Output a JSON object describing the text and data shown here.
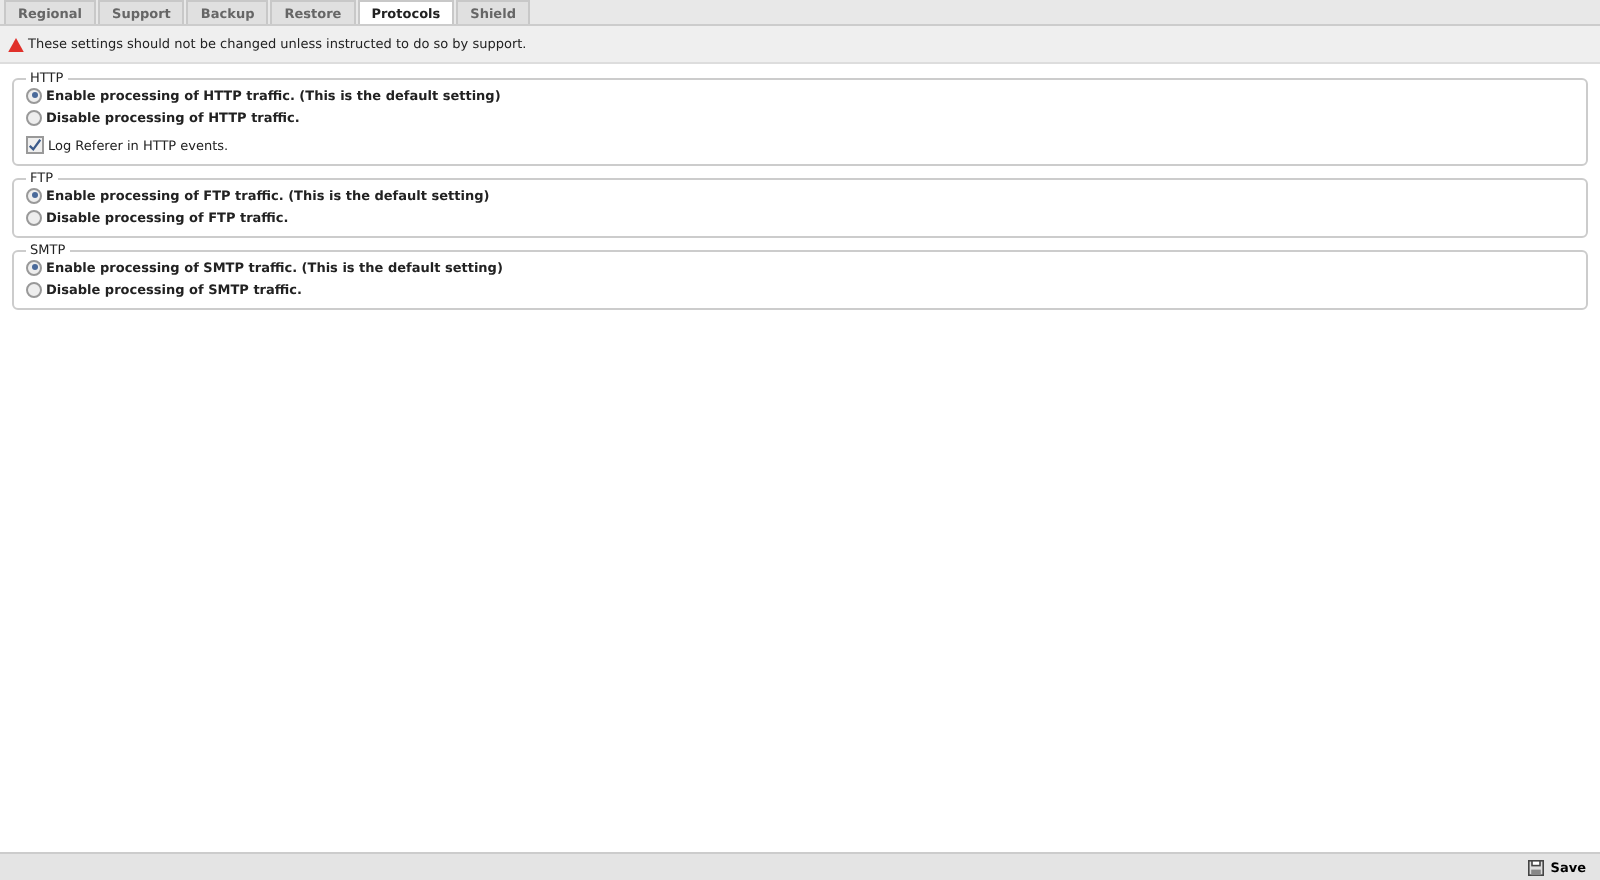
{
  "tabs": [
    {
      "label": "Regional",
      "selected": false
    },
    {
      "label": "Support",
      "selected": false
    },
    {
      "label": "Backup",
      "selected": false
    },
    {
      "label": "Restore",
      "selected": false
    },
    {
      "label": "Protocols",
      "selected": true
    },
    {
      "label": "Shield",
      "selected": false
    }
  ],
  "warning": "These settings should not be changed unless instructed to do so by support.",
  "groups": [
    {
      "legend": "HTTP",
      "items": [
        {
          "kind": "radio",
          "label": "Enable processing of HTTP traffic. (This is the default setting)",
          "selected": true
        },
        {
          "kind": "radio",
          "label": "Disable processing of HTTP traffic.",
          "selected": false
        },
        {
          "kind": "checkbox",
          "label": "Log Referer in HTTP events.",
          "checked": true
        }
      ]
    },
    {
      "legend": "FTP",
      "items": [
        {
          "kind": "radio",
          "label": "Enable processing of FTP traffic. (This is the default setting)",
          "selected": true
        },
        {
          "kind": "radio",
          "label": "Disable processing of FTP traffic.",
          "selected": false
        }
      ]
    },
    {
      "legend": "SMTP",
      "items": [
        {
          "kind": "radio",
          "label": "Enable processing of SMTP traffic. (This is the default setting)",
          "selected": true
        },
        {
          "kind": "radio",
          "label": "Disable processing of SMTP traffic.",
          "selected": false
        }
      ]
    }
  ],
  "footer": {
    "save": "Save"
  }
}
